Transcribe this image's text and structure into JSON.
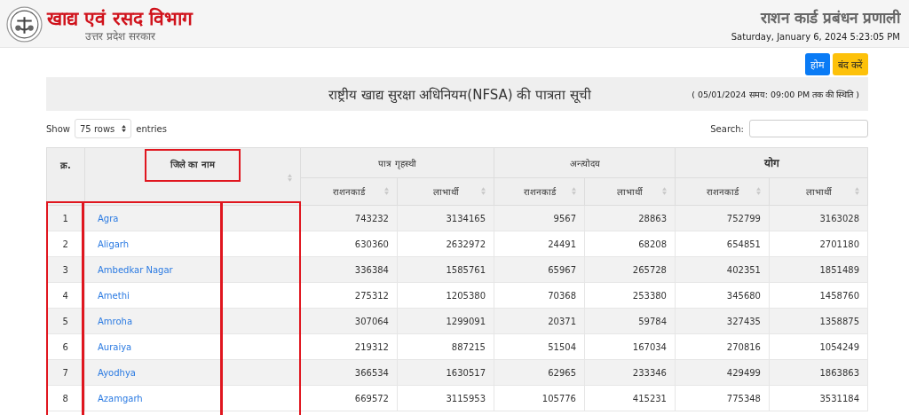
{
  "header": {
    "department": "खाद्य एवं रसद विभाग",
    "government": "उत्तर प्रदेश सरकार",
    "system_title": "राशन कार्ड प्रबंधन प्रणाली",
    "datetime": "Saturday, January 6, 2024 5:23:05 PM"
  },
  "buttons": [
    {
      "label": "होम",
      "kind": "primary"
    },
    {
      "label": "बंद करें",
      "kind": "warning"
    }
  ],
  "report": {
    "title": "राष्ट्रीय खाद्य सुरक्षा अधिनियम(NFSA) की पात्रता सूची",
    "status": "( 05/01/2024 समय: 09:00 PM तक की स्थिति )"
  },
  "length_control": {
    "label_before": "Show",
    "value": "75 rows",
    "label_after": "entries"
  },
  "search": {
    "label": "Search:"
  },
  "table": {
    "groups": [
      {
        "kind": "single",
        "label": "क्र.",
        "sortable": false,
        "outlined": false
      },
      {
        "kind": "single",
        "label": "जिले का नाम",
        "sortable": true,
        "outlined": true
      },
      {
        "kind": "group",
        "label": "पात्र गृहस्थी",
        "large": false
      },
      {
        "kind": "group",
        "label": "अन्त्योदय",
        "large": false
      },
      {
        "kind": "group",
        "label": "योग",
        "large": true
      }
    ],
    "subcolumns": [
      "राशनकार्ड",
      "लाभार्थी",
      "राशनकार्ड",
      "लाभार्थी",
      "राशनकार्ड",
      "लाभार्थी"
    ],
    "body_outlined": true,
    "rows": [
      [
        "1",
        "Agra",
        "743232",
        "3134165",
        "9567",
        "28863",
        "752799",
        "3163028"
      ],
      [
        "2",
        "Aligarh",
        "630360",
        "2632972",
        "24491",
        "68208",
        "654851",
        "2701180"
      ],
      [
        "3",
        "Ambedkar Nagar",
        "336384",
        "1585761",
        "65967",
        "265728",
        "402351",
        "1851489"
      ],
      [
        "4",
        "Amethi",
        "275312",
        "1205380",
        "70368",
        "253380",
        "345680",
        "1458760"
      ],
      [
        "5",
        "Amroha",
        "307064",
        "1299091",
        "20371",
        "59784",
        "327435",
        "1358875"
      ],
      [
        "6",
        "Auraiya",
        "219312",
        "887215",
        "51504",
        "167034",
        "270816",
        "1054249"
      ],
      [
        "7",
        "Ayodhya",
        "366534",
        "1630517",
        "62965",
        "233346",
        "429499",
        "1863863"
      ],
      [
        "8",
        "Azamgarh",
        "669572",
        "3115953",
        "105776",
        "415231",
        "775348",
        "3531184"
      ]
    ]
  }
}
